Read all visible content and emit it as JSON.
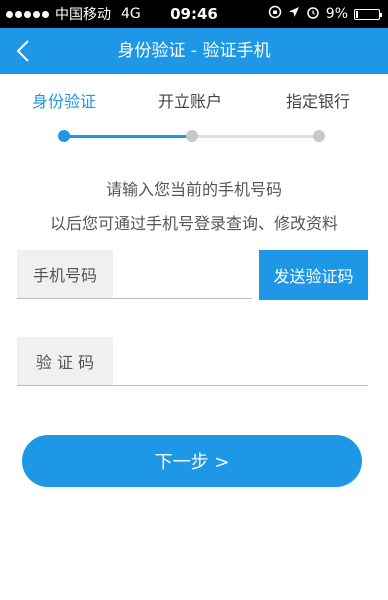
{
  "status_bar": {
    "carrier": "中国移动",
    "network": "4G",
    "time": "09:46",
    "battery_percent": "9%",
    "battery_level": 0.09,
    "icons": [
      "signal-dots-icon",
      "lock-rotation-icon",
      "location-arrow-icon",
      "alarm-icon",
      "battery-icon"
    ]
  },
  "navbar": {
    "title": "身份验证 - 验证手机",
    "back_icon": "chevron-left-icon"
  },
  "steps": {
    "items": [
      {
        "label": "身份验证",
        "state": "active"
      },
      {
        "label": "开立账户",
        "state": "pending"
      },
      {
        "label": "指定银行",
        "state": "pending"
      }
    ]
  },
  "instructions": {
    "line1": "请输入您当前的手机号码",
    "line2": "以后您可通过手机号登录查询、修改资料"
  },
  "form": {
    "phone_label": "手机号码",
    "phone_value": "",
    "send_code_button": "发送验证码",
    "code_label": "验 证 码",
    "code_value": ""
  },
  "actions": {
    "next_button": "下一步 >"
  },
  "colors": {
    "accent": "#1d97e6",
    "inactive_track": "#e0e0e0",
    "inactive_dot": "#c8c8c8",
    "label_bg": "#f0f0f0"
  }
}
